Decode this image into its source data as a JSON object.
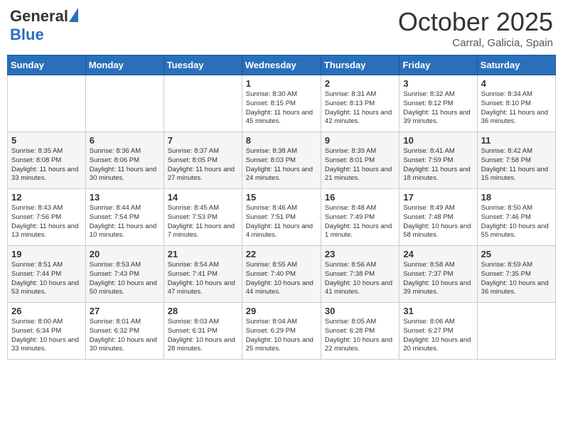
{
  "header": {
    "logo_general": "General",
    "logo_blue": "Blue",
    "month_title": "October 2025",
    "location": "Carral, Galicia, Spain"
  },
  "weekdays": [
    "Sunday",
    "Monday",
    "Tuesday",
    "Wednesday",
    "Thursday",
    "Friday",
    "Saturday"
  ],
  "weeks": [
    [
      {
        "day": "",
        "info": ""
      },
      {
        "day": "",
        "info": ""
      },
      {
        "day": "",
        "info": ""
      },
      {
        "day": "1",
        "info": "Sunrise: 8:30 AM\nSunset: 8:15 PM\nDaylight: 11 hours and 45 minutes."
      },
      {
        "day": "2",
        "info": "Sunrise: 8:31 AM\nSunset: 8:13 PM\nDaylight: 11 hours and 42 minutes."
      },
      {
        "day": "3",
        "info": "Sunrise: 8:32 AM\nSunset: 8:12 PM\nDaylight: 11 hours and 39 minutes."
      },
      {
        "day": "4",
        "info": "Sunrise: 8:34 AM\nSunset: 8:10 PM\nDaylight: 11 hours and 36 minutes."
      }
    ],
    [
      {
        "day": "5",
        "info": "Sunrise: 8:35 AM\nSunset: 8:08 PM\nDaylight: 11 hours and 33 minutes."
      },
      {
        "day": "6",
        "info": "Sunrise: 8:36 AM\nSunset: 8:06 PM\nDaylight: 11 hours and 30 minutes."
      },
      {
        "day": "7",
        "info": "Sunrise: 8:37 AM\nSunset: 8:05 PM\nDaylight: 11 hours and 27 minutes."
      },
      {
        "day": "8",
        "info": "Sunrise: 8:38 AM\nSunset: 8:03 PM\nDaylight: 11 hours and 24 minutes."
      },
      {
        "day": "9",
        "info": "Sunrise: 8:39 AM\nSunset: 8:01 PM\nDaylight: 11 hours and 21 minutes."
      },
      {
        "day": "10",
        "info": "Sunrise: 8:41 AM\nSunset: 7:59 PM\nDaylight: 11 hours and 18 minutes."
      },
      {
        "day": "11",
        "info": "Sunrise: 8:42 AM\nSunset: 7:58 PM\nDaylight: 11 hours and 15 minutes."
      }
    ],
    [
      {
        "day": "12",
        "info": "Sunrise: 8:43 AM\nSunset: 7:56 PM\nDaylight: 11 hours and 13 minutes."
      },
      {
        "day": "13",
        "info": "Sunrise: 8:44 AM\nSunset: 7:54 PM\nDaylight: 11 hours and 10 minutes."
      },
      {
        "day": "14",
        "info": "Sunrise: 8:45 AM\nSunset: 7:53 PM\nDaylight: 11 hours and 7 minutes."
      },
      {
        "day": "15",
        "info": "Sunrise: 8:46 AM\nSunset: 7:51 PM\nDaylight: 11 hours and 4 minutes."
      },
      {
        "day": "16",
        "info": "Sunrise: 8:48 AM\nSunset: 7:49 PM\nDaylight: 11 hours and 1 minute."
      },
      {
        "day": "17",
        "info": "Sunrise: 8:49 AM\nSunset: 7:48 PM\nDaylight: 10 hours and 58 minutes."
      },
      {
        "day": "18",
        "info": "Sunrise: 8:50 AM\nSunset: 7:46 PM\nDaylight: 10 hours and 55 minutes."
      }
    ],
    [
      {
        "day": "19",
        "info": "Sunrise: 8:51 AM\nSunset: 7:44 PM\nDaylight: 10 hours and 53 minutes."
      },
      {
        "day": "20",
        "info": "Sunrise: 8:53 AM\nSunset: 7:43 PM\nDaylight: 10 hours and 50 minutes."
      },
      {
        "day": "21",
        "info": "Sunrise: 8:54 AM\nSunset: 7:41 PM\nDaylight: 10 hours and 47 minutes."
      },
      {
        "day": "22",
        "info": "Sunrise: 8:55 AM\nSunset: 7:40 PM\nDaylight: 10 hours and 44 minutes."
      },
      {
        "day": "23",
        "info": "Sunrise: 8:56 AM\nSunset: 7:38 PM\nDaylight: 10 hours and 41 minutes."
      },
      {
        "day": "24",
        "info": "Sunrise: 8:58 AM\nSunset: 7:37 PM\nDaylight: 10 hours and 39 minutes."
      },
      {
        "day": "25",
        "info": "Sunrise: 8:59 AM\nSunset: 7:35 PM\nDaylight: 10 hours and 36 minutes."
      }
    ],
    [
      {
        "day": "26",
        "info": "Sunrise: 8:00 AM\nSunset: 6:34 PM\nDaylight: 10 hours and 33 minutes."
      },
      {
        "day": "27",
        "info": "Sunrise: 8:01 AM\nSunset: 6:32 PM\nDaylight: 10 hours and 30 minutes."
      },
      {
        "day": "28",
        "info": "Sunrise: 8:03 AM\nSunset: 6:31 PM\nDaylight: 10 hours and 28 minutes."
      },
      {
        "day": "29",
        "info": "Sunrise: 8:04 AM\nSunset: 6:29 PM\nDaylight: 10 hours and 25 minutes."
      },
      {
        "day": "30",
        "info": "Sunrise: 8:05 AM\nSunset: 6:28 PM\nDaylight: 10 hours and 22 minutes."
      },
      {
        "day": "31",
        "info": "Sunrise: 8:06 AM\nSunset: 6:27 PM\nDaylight: 10 hours and 20 minutes."
      },
      {
        "day": "",
        "info": ""
      }
    ]
  ]
}
